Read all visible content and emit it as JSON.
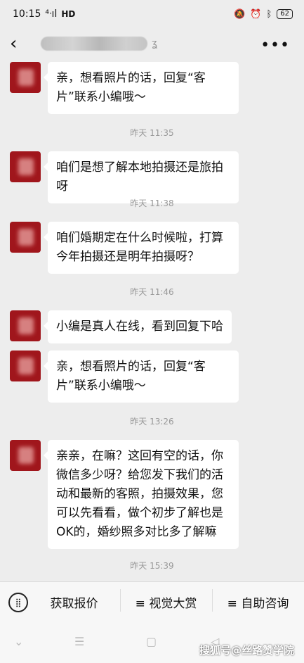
{
  "status": {
    "time": "10:15",
    "network": "HD",
    "battery": "62"
  },
  "header": {
    "more_label": "•••"
  },
  "messages": [
    {
      "text": "亲，想看照片的话，回复“客片”联系小编哦～"
    },
    {
      "text": "咱们是想了解本地拍摄还是旅拍呀"
    },
    {
      "text": "咱们婚期定在什么时候啦，打算今年拍摄还是明年拍摄呀？"
    },
    {
      "text": "小编是真人在线，看到回复下哈"
    },
    {
      "text": "亲，想看照片的话，回复“客片”联系小编哦～"
    },
    {
      "text": "亲亲，在嘛？这回有空的话，你微信多少呀？给您发下我们的活动和最新的客照，拍摄效果，您可以先看看，做个初步了解也是OK的，婚纱照多对比多了解嘛"
    }
  ],
  "timestamps": [
    "昨天 11:35",
    "昨天 11:38",
    "昨天 11:46",
    "昨天 13:26",
    "昨天 15:39"
  ],
  "bottom_menu": [
    {
      "label": "获取报价"
    },
    {
      "label": "≡ 视觉大赏"
    },
    {
      "label": "≡ 自助咨询"
    }
  ],
  "watermark": "搜狐号@丝路赞学院"
}
